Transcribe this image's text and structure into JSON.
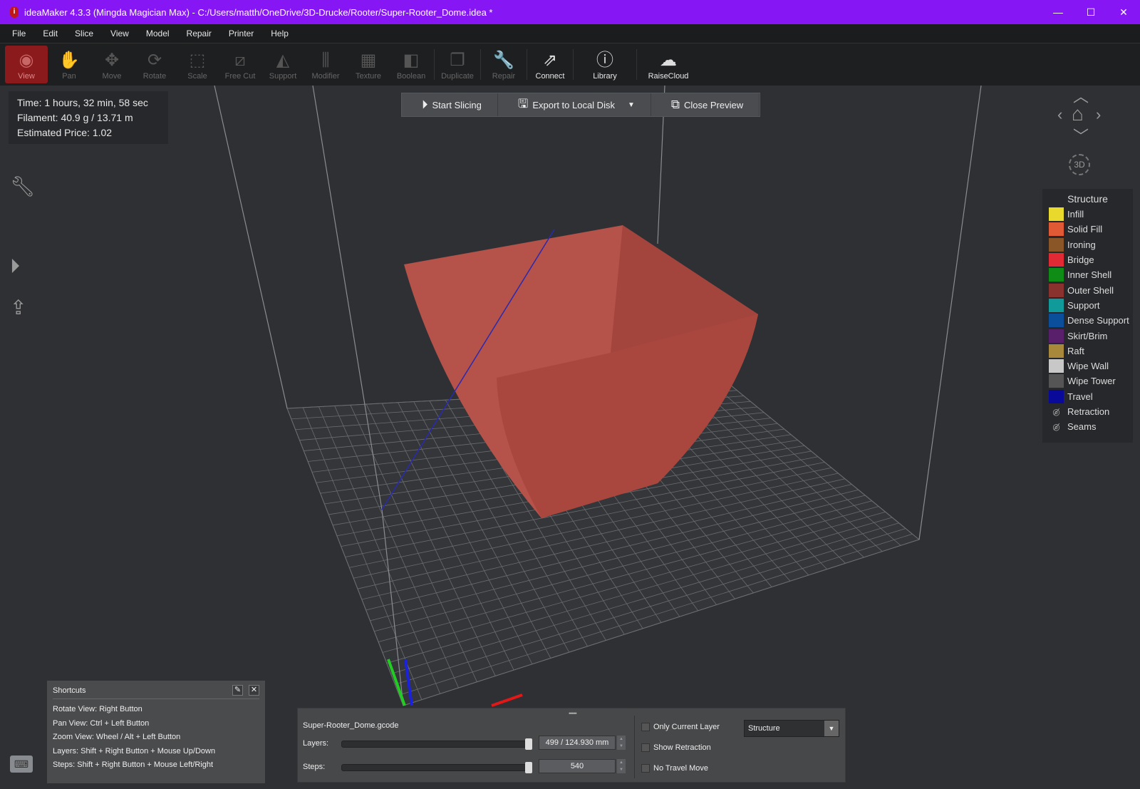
{
  "titlebar": {
    "title": "ideaMaker 4.3.3 (Mingda Magician Max) - C:/Users/matth/OneDrive/3D-Drucke/Rooter/Super-Rooter_Dome.idea *",
    "minimize": "—",
    "maximize": "☐",
    "close": "✕"
  },
  "menu": [
    "File",
    "Edit",
    "Slice",
    "View",
    "Model",
    "Repair",
    "Printer",
    "Help"
  ],
  "toolbar": [
    {
      "label": "View",
      "icon": "eye-icon",
      "glyph": "◉",
      "state": "active"
    },
    {
      "label": "Pan",
      "icon": "hand-icon",
      "glyph": "✋",
      "state": "disabled"
    },
    {
      "label": "Move",
      "icon": "move-icon",
      "glyph": "✥",
      "state": "disabled"
    },
    {
      "label": "Rotate",
      "icon": "rotate-icon",
      "glyph": "⟳",
      "state": "disabled"
    },
    {
      "label": "Scale",
      "icon": "scale-icon",
      "glyph": "⬚",
      "state": "disabled"
    },
    {
      "label": "Free Cut",
      "icon": "cut-icon",
      "glyph": "⧄",
      "state": "disabled"
    },
    {
      "label": "Support",
      "icon": "support-icon",
      "glyph": "◭",
      "state": "disabled"
    },
    {
      "label": "Modifier",
      "icon": "modifier-icon",
      "glyph": "⫼",
      "state": "disabled"
    },
    {
      "label": "Texture",
      "icon": "texture-icon",
      "glyph": "▦",
      "state": "disabled"
    },
    {
      "label": "Boolean",
      "icon": "boolean-icon",
      "glyph": "◧",
      "state": "disabled"
    },
    {
      "label": "Duplicate",
      "icon": "duplicate-icon",
      "glyph": "❐",
      "state": "disabled"
    },
    {
      "label": "Repair",
      "icon": "wrench-plus-icon",
      "glyph": "🔧",
      "state": "disabled"
    },
    {
      "label": "Connect",
      "icon": "connect-icon",
      "glyph": "⇗",
      "state": "enabled"
    },
    {
      "label": "Library",
      "icon": "library-icon",
      "glyph": "ⓘ",
      "state": "enabled"
    },
    {
      "label": "RaiseCloud",
      "icon": "cloud-icon",
      "glyph": "☁",
      "state": "enabled"
    }
  ],
  "info": {
    "time": "Time: 1 hours, 32 min, 58 sec",
    "filament": "Filament: 40.9 g / 13.71 m",
    "price": "Estimated Price: 1.02"
  },
  "actions": {
    "start": "Start Slicing",
    "export": "Export to Local Disk",
    "close": "Close Preview"
  },
  "nav": {
    "view3d": "3D"
  },
  "legend": {
    "title": "Structure",
    "items": [
      {
        "label": "Infill",
        "color": "#e8d92c"
      },
      {
        "label": "Solid Fill",
        "color": "#df5a35"
      },
      {
        "label": "Ironing",
        "color": "#8a5628"
      },
      {
        "label": "Bridge",
        "color": "#e22a35"
      },
      {
        "label": "Inner Shell",
        "color": "#0f8c15"
      },
      {
        "label": "Outer Shell",
        "color": "#8a322d"
      },
      {
        "label": "Support",
        "color": "#109a9a"
      },
      {
        "label": "Dense Support",
        "color": "#0b4f9a"
      },
      {
        "label": "Skirt/Brim",
        "color": "#5a1f6a"
      },
      {
        "label": "Raft",
        "color": "#a8883a"
      },
      {
        "label": "Wipe Wall",
        "color": "#c8c8c8"
      },
      {
        "label": "Wipe Tower",
        "color": "#555555"
      },
      {
        "label": "Travel",
        "color": "#0a0a9a"
      }
    ],
    "toggles": [
      "Retraction",
      "Seams"
    ]
  },
  "shortcuts": {
    "title": "Shortcuts",
    "lines": [
      "Rotate View: Right Button",
      "Pan View: Ctrl + Left Button",
      "Zoom View: Wheel / Alt + Left Button",
      "Layers: Shift + Right Button + Mouse Up/Down",
      "Steps: Shift + Right Button + Mouse Left/Right"
    ]
  },
  "preview": {
    "filename": "Super-Rooter_Dome.gcode",
    "layers_label": "Layers:",
    "layers_value": "499 / 124.930 mm",
    "layers_fraction": 1.0,
    "steps_label": "Steps:",
    "steps_value": "540",
    "steps_fraction": 1.0,
    "only_current_layer": "Only Current Layer",
    "show_retraction": "Show Retraction",
    "no_travel_move": "No Travel Move",
    "view_mode": "Structure"
  },
  "model_color": "#b5524a"
}
